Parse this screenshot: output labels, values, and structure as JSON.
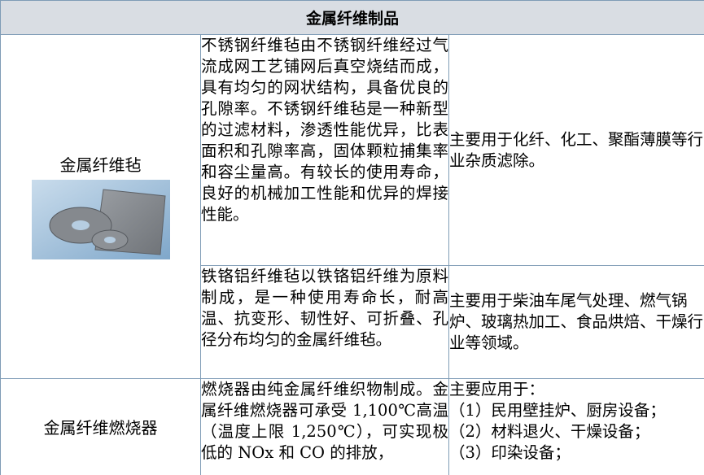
{
  "table": {
    "title": "金属纤维制品",
    "felt": {
      "name": "金属纤维毡",
      "image_icon": "metal-fiber-felt-photo",
      "rows": [
        {
          "description": "不锈钢纤维毡由不锈钢纤维经过气流成网工艺铺网后真空烧结而成，具有均匀的网状结构，具备优良的孔隙率。不锈钢纤维毡是一种新型的过滤材料，渗透性能优异，比表面积和孔隙率高，固体颗粒捕集率和容尘量高。有较长的使用寿命，良好的机械加工性能和优异的焊接性能。",
          "application": "主要用于化纤、化工、聚酯薄膜等行业杂质滤除。"
        },
        {
          "description": "铁铬铝纤维毡以铁铬铝纤维为原料制成，是一种使用寿命长，耐高温、抗变形、韧性好、可折叠、孔径分布均匀的金属纤维毡。",
          "application": "主要用于柴油车尾气处理、燃气锅炉、玻璃热加工、食品烘焙、干燥行业等领域。"
        }
      ]
    },
    "burner": {
      "name": "金属纤维燃烧器",
      "description": "燃烧器由纯金属纤维织物制成。金属纤维燃烧器可承受 1,100℃高温（温度上限 1,250℃），可实现极低的 NOx 和 CO 的排放，",
      "application_lines": [
        "主要应用于：",
        "（1）民用壁挂炉、厨房设备；",
        "（2）材料退火、干燥设备；",
        "（3）印染设备；"
      ]
    }
  },
  "colors": {
    "border": "#7f9cb6",
    "header_bg": "#d9dde3",
    "photo_bg": "#a7c6e1"
  }
}
